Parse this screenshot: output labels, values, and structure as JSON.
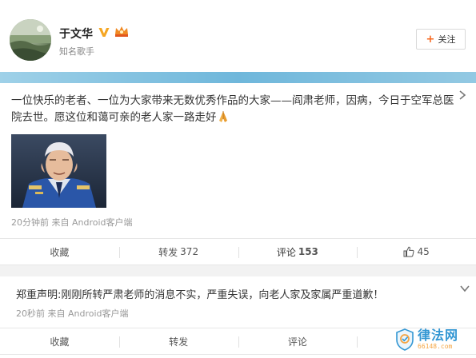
{
  "user": {
    "name": "于文华",
    "description": "知名歌手",
    "verified_icon": "verified-v-icon",
    "vip_icon": "vip-crown-icon",
    "follow_label": "关注"
  },
  "post": {
    "text": "一位快乐的老者、一位为大家带来无数优秀作品的大家——阎肃老师，因病，今日于空军总医院去世。愿这位和蔼可亲的老人家一路走好",
    "emoji": "pray-icon",
    "meta": "20分钟前 来自 Android客户端",
    "actions": {
      "favorite_label": "收藏",
      "repost_label": "转发",
      "repost_count": "372",
      "comment_label": "评论",
      "comment_count": "153",
      "like_count": "45"
    }
  },
  "notice": {
    "text": "郑重声明:刚刚所转严肃老师的消息不实，严重失误，向老人家及家属严重道歉！",
    "meta": "20秒前 来自 Android客户端",
    "actions": {
      "favorite_label": "收藏",
      "repost_label": "转发",
      "comment_label": "评论"
    }
  },
  "watermark": {
    "title": "律法网",
    "subtitle": "66148.com"
  },
  "colors": {
    "accent_blue": "#6fb7db",
    "follow_plus": "#f7671d",
    "watermark_blue": "#1f8ccf",
    "watermark_orange": "#f39b2e"
  }
}
